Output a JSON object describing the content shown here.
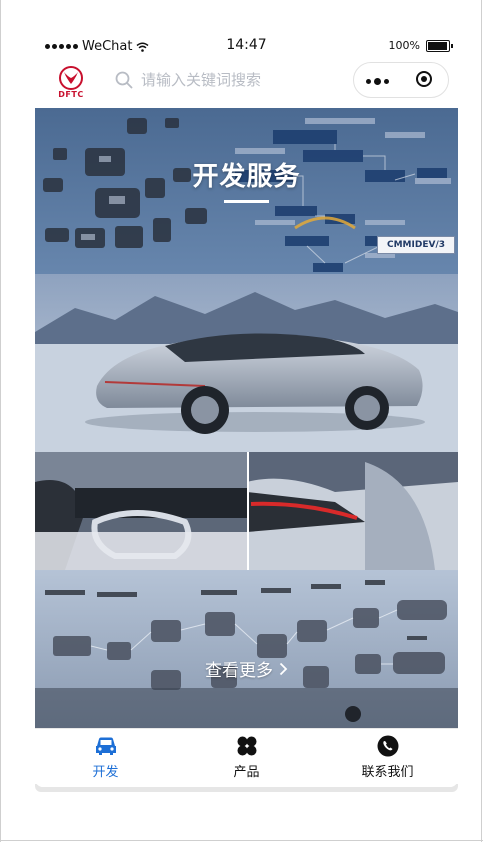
{
  "status_bar": {
    "carrier": "WeChat",
    "time": "14:47",
    "battery": "100%"
  },
  "nav": {
    "logo_text": "DFTC",
    "search_placeholder": "请输入关键词搜索"
  },
  "hero": {
    "title": "开发服务",
    "badge": "CMMIDEV/3"
  },
  "more": {
    "label": "查看更多"
  },
  "tabs": [
    {
      "label": "开发",
      "icon": "car-icon",
      "active": true
    },
    {
      "label": "产品",
      "icon": "four-leaf-icon",
      "active": false
    },
    {
      "label": "联系我们",
      "icon": "phone-icon",
      "active": false
    }
  ],
  "colors": {
    "accent": "#1d6fd6",
    "brand_red": "#c8102e"
  }
}
